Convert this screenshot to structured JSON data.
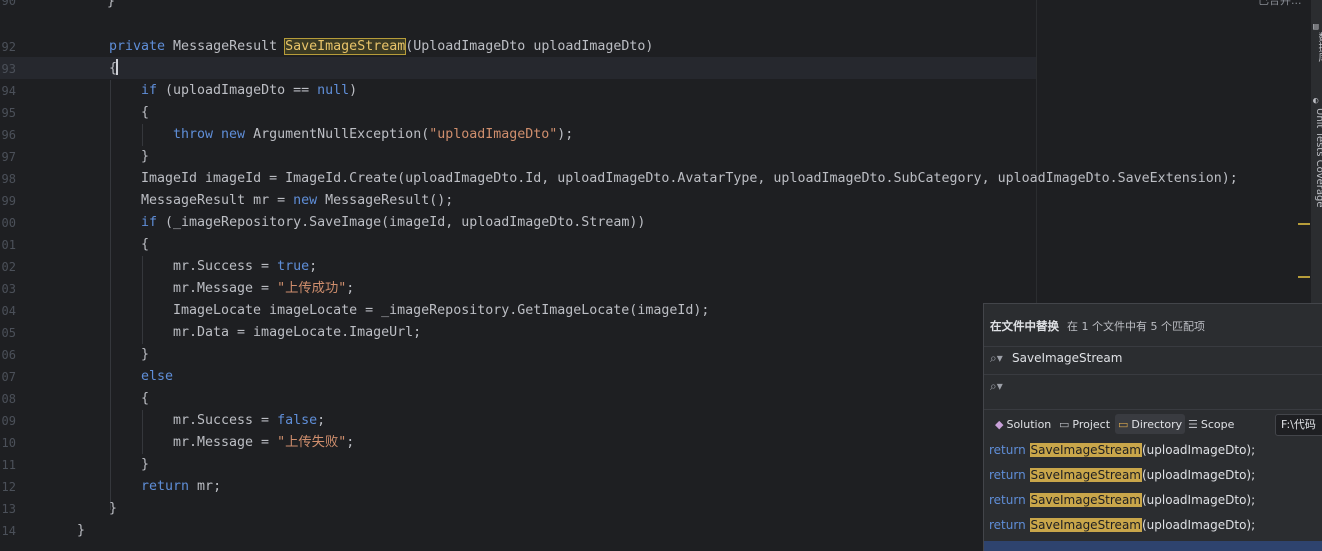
{
  "editor": {
    "top_right_label": "已合并...",
    "line_numbers": [
      "90",
      "92",
      "93",
      "94",
      "95",
      "96",
      "97",
      "98",
      "99",
      "00",
      "01",
      "02",
      "03",
      "04",
      "05",
      "06",
      "07",
      "08",
      "09",
      "10",
      "11",
      "12",
      "13",
      "14"
    ],
    "tokens": {
      "l90": "}",
      "l92_kw": "private",
      "l92_type": " MessageResult ",
      "l92_method": "SaveImageStream",
      "l92_rest": "(UploadImageDto uploadImageDto)",
      "l93": "{",
      "l94_kw": "if",
      "l94_a": " (uploadImageDto == ",
      "l94_null": "null",
      "l94_b": ")",
      "l95": "{",
      "l96_kw": "throw",
      "l96_sp": " ",
      "l96_new": "new",
      "l96_a": " ArgumentNullException(",
      "l96_str": "\"uploadImageDto\"",
      "l96_b": ");",
      "l97": "}",
      "l98": "ImageId imageId = ImageId.Create(uploadImageDto.Id, uploadImageDto.AvatarType, uploadImageDto.SubCategory, uploadImageDto.SaveExtension);",
      "l99_a": "MessageResult mr = ",
      "l99_new": "new",
      "l99_b": " MessageResult();",
      "l100_kw": "if",
      "l100_a": " (_imageRepository.SaveImage(imageId, uploadImageDto.Stream))",
      "l101": "{",
      "l102_a": "mr.Success = ",
      "l102_true": "true",
      "l102_b": ";",
      "l103_a": "mr.Message = ",
      "l103_str": "\"上传成功\"",
      "l103_b": ";",
      "l104": "ImageLocate imageLocate = _imageRepository.GetImageLocate(imageId);",
      "l105": "mr.Data = imageLocate.ImageUrl;",
      "l106": "}",
      "l107_kw": "else",
      "l108": "{",
      "l109_a": "mr.Success = ",
      "l109_false": "false",
      "l109_b": ";",
      "l110_a": "mr.Message = ",
      "l110_str": "\"上传失败\"",
      "l110_b": ";",
      "l111": "}",
      "l112_kw": "return",
      "l112_a": " mr;",
      "l113": "}",
      "l114": "}"
    }
  },
  "toolstrip": {
    "label_1": "数据库",
    "label_2": "Unit Tests Coverage"
  },
  "find_panel": {
    "title": "在文件中替换",
    "subtitle": "在 1 个文件中有 5 个匹配项",
    "search_value": "SaveImageStream",
    "replace_value": "",
    "search_icon": "search-icon",
    "tabs": [
      {
        "label": "Solution",
        "icon": "solution-icon",
        "active": false
      },
      {
        "label": "Project",
        "icon": "project-icon",
        "active": false
      },
      {
        "label": "Directory",
        "icon": "folder-icon",
        "active": true
      },
      {
        "label": "Scope",
        "icon": "scope-icon",
        "active": false
      }
    ],
    "directory_value": "F:\\代码",
    "results": [
      {
        "keyword": "return",
        "match": "SaveImageStream",
        "rest": "(uploadImageDto);"
      },
      {
        "keyword": "return",
        "match": "SaveImageStream",
        "rest": "(uploadImageDto);"
      },
      {
        "keyword": "return",
        "match": "SaveImageStream",
        "rest": "(uploadImageDto);"
      },
      {
        "keyword": "return",
        "match": "SaveImageStream",
        "rest": "(uploadImageDto);"
      }
    ]
  },
  "colors": {
    "background": "#1e1f22",
    "keyword": "#cf8e6d",
    "string": "#6aab73",
    "match_highlight": "#c9a64a",
    "panel": "#2b2d30"
  }
}
